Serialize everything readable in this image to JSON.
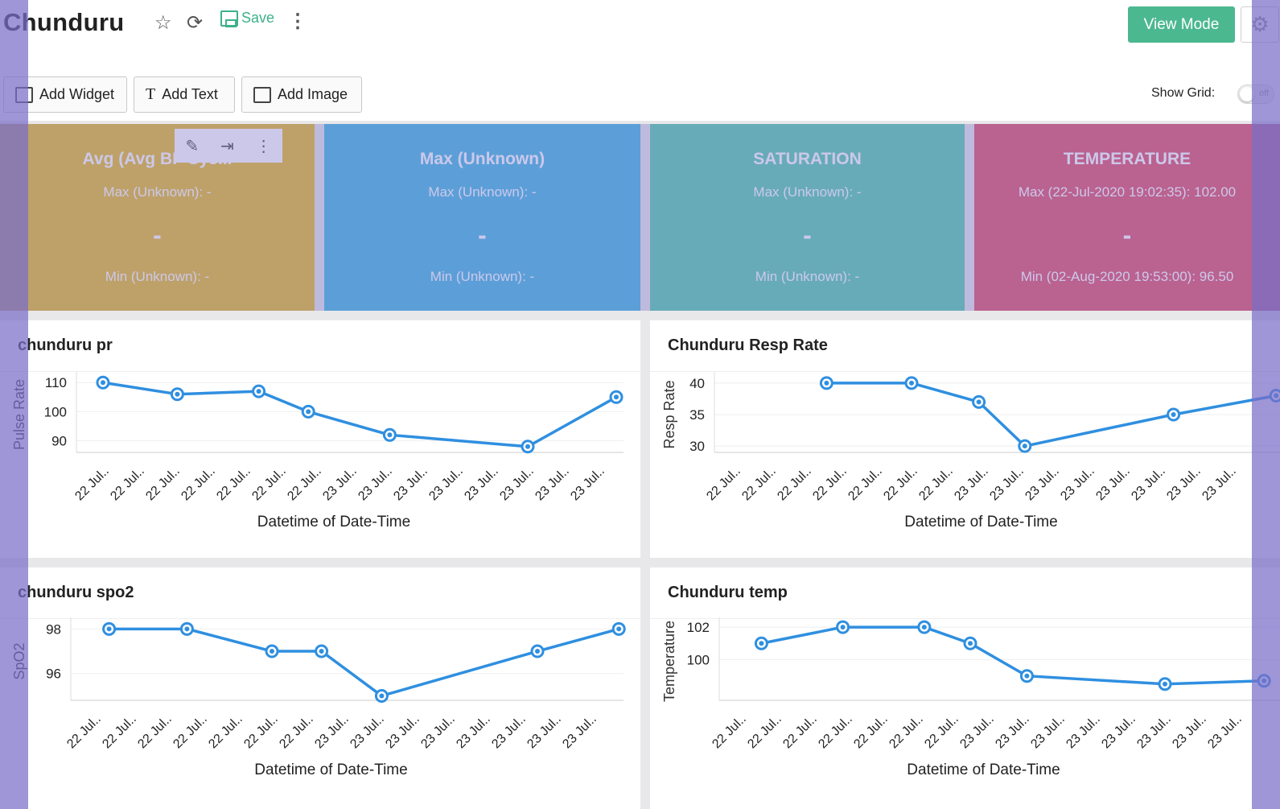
{
  "header": {
    "title": "Chunduru",
    "save_label": "Save",
    "view_mode_label": "View Mode",
    "icons": [
      "star-icon",
      "refresh-icon",
      "save-icon",
      "more-icon",
      "gear-icon"
    ]
  },
  "toolbar": {
    "add_widget": "Add Widget",
    "add_text": "Add Text",
    "add_image": "Add Image",
    "show_grid_label": "Show Grid:",
    "show_grid_state": "off"
  },
  "kpis": [
    {
      "title": "Avg (Avg BP Sys...",
      "max": "Max (Unknown): -",
      "value": "-",
      "min": "Min (Unknown): -",
      "color": "#e9c130"
    },
    {
      "title": "Max (Unknown)",
      "max": "Max (Unknown): -",
      "value": "-",
      "min": "Min (Unknown): -",
      "color": "#4bbde2"
    },
    {
      "title": "SATURATION",
      "max": "Max (Unknown): -",
      "value": "-",
      "min": "Min (Unknown): -",
      "color": "#5cd1b0"
    },
    {
      "title": "TEMPERATURE",
      "max": "Max (22-Jul-2020 19:02:35): 102.00",
      "value": "-",
      "min": "Min (02-Aug-2020 19:53:00): 96.50",
      "color": "#e35b6e"
    }
  ],
  "chart_data": [
    {
      "type": "line",
      "title": "chunduru pr",
      "ylabel": "Pulse Rate",
      "xlabel": "Datetime of Date-Time",
      "x_ticks": [
        "22 Jul..",
        "22 Jul..",
        "22 Jul..",
        "22 Jul..",
        "22 Jul..",
        "22 Jul..",
        "22 Jul..",
        "23 Jul..",
        "23 Jul..",
        "23 Jul..",
        "23 Jul..",
        "23 Jul..",
        "23 Jul..",
        "23 Jul..",
        "23 Jul.."
      ],
      "y_ticks": [
        90,
        100,
        110
      ],
      "ylim": [
        86,
        112
      ],
      "series": [
        {
          "values": [
            [
              0,
              110
            ],
            [
              2.1,
              106
            ],
            [
              4.4,
              107
            ],
            [
              5.8,
              100
            ],
            [
              8.1,
              92
            ],
            [
              12.0,
              88
            ],
            [
              14.5,
              105
            ]
          ]
        }
      ]
    },
    {
      "type": "line",
      "title": "Chunduru Resp Rate",
      "ylabel": "Resp Rate",
      "xlabel": "Datetime of Date-Time",
      "x_ticks": [
        "22 Jul..",
        "22 Jul..",
        "22 Jul..",
        "22 Jul..",
        "22 Jul..",
        "22 Jul..",
        "22 Jul..",
        "23 Jul..",
        "23 Jul..",
        "23 Jul..",
        "23 Jul..",
        "23 Jul..",
        "23 Jul..",
        "23 Jul..",
        "23 Jul.."
      ],
      "y_ticks": [
        30,
        35,
        40
      ],
      "ylim": [
        29,
        41
      ],
      "series": [
        {
          "values": [
            [
              2.6,
              40
            ],
            [
              5.0,
              40
            ],
            [
              6.9,
              37
            ],
            [
              8.2,
              30
            ],
            [
              12.4,
              35
            ],
            [
              15.3,
              38
            ]
          ]
        }
      ]
    },
    {
      "type": "line",
      "title": "chunduru spo2",
      "ylabel": "SpO2",
      "xlabel": "Datetime of Date-Time",
      "x_ticks": [
        "22 Jul..",
        "22 Jul..",
        "22 Jul..",
        "22 Jul..",
        "22 Jul..",
        "22 Jul..",
        "22 Jul..",
        "23 Jul..",
        "23 Jul..",
        "23 Jul..",
        "23 Jul..",
        "23 Jul..",
        "23 Jul..",
        "23 Jul..",
        "23 Jul.."
      ],
      "y_ticks": [
        96,
        98
      ],
      "ylim": [
        94.8,
        98.3
      ],
      "series": [
        {
          "values": [
            [
              0.4,
              98
            ],
            [
              2.6,
              98
            ],
            [
              5.0,
              97
            ],
            [
              6.4,
              97
            ],
            [
              8.1,
              95
            ],
            [
              12.5,
              97
            ],
            [
              14.8,
              98
            ]
          ]
        }
      ]
    },
    {
      "type": "line",
      "title": "Chunduru temp",
      "ylabel": "Temperature",
      "xlabel": "Datetime of Date-Time",
      "x_ticks": [
        "22 Jul..",
        "22 Jul..",
        "22 Jul..",
        "22 Jul..",
        "22 Jul..",
        "22 Jul..",
        "22 Jul..",
        "23 Jul..",
        "23 Jul..",
        "23 Jul..",
        "23 Jul..",
        "23 Jul..",
        "23 Jul..",
        "23 Jul..",
        "23 Jul.."
      ],
      "y_ticks": [
        100,
        102
      ],
      "ylim": [
        97.5,
        102.3
      ],
      "series": [
        {
          "values": [
            [
              0.6,
              101
            ],
            [
              2.9,
              102
            ],
            [
              5.2,
              102
            ],
            [
              6.5,
              101
            ],
            [
              8.1,
              99
            ],
            [
              12.0,
              98.5
            ],
            [
              14.8,
              98.7
            ]
          ]
        }
      ]
    }
  ]
}
